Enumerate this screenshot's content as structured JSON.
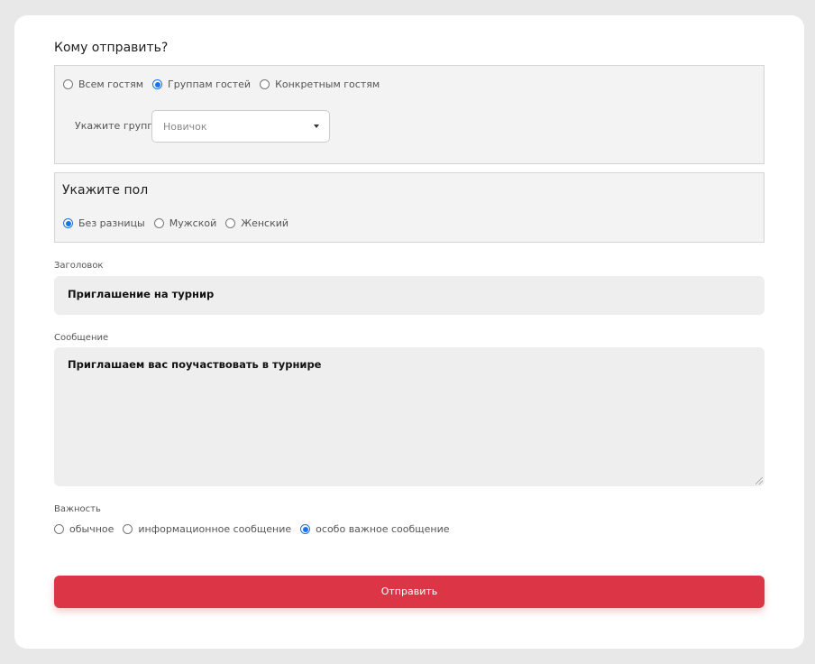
{
  "who": {
    "title": "Кому отправить?",
    "options": [
      "Всем гостям",
      "Группам гостей",
      "Конкретным гостям"
    ],
    "selected": 1,
    "groups_label": "Укажите группы",
    "groups_select": {
      "placeholder": "Новичок"
    }
  },
  "gender": {
    "title": "Укажите пол",
    "options": [
      "Без разницы",
      "Мужской",
      "Женский"
    ],
    "selected": 0
  },
  "subject": {
    "label": "Заголовок",
    "value": "Приглашение на турнир"
  },
  "message": {
    "label": "Сообщение",
    "value": "Приглашаем вас поучаствовать в турнире"
  },
  "importance": {
    "label": "Важность",
    "options": [
      "обычное",
      "информационное сообщение",
      "особо важное сообщение"
    ],
    "selected": 2
  },
  "submit": {
    "label": "Отправить"
  },
  "colors": {
    "accent": "#dc3545",
    "radio": "#1a73e8",
    "page_bg": "#e8e8e8"
  }
}
